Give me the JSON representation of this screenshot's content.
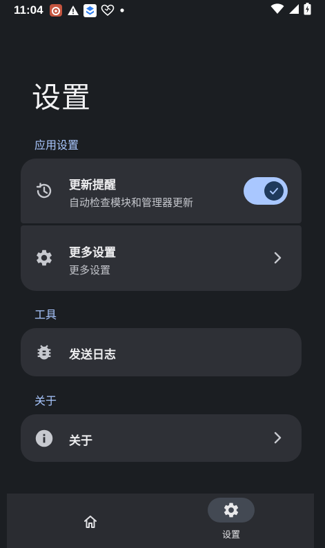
{
  "status_bar": {
    "time": "11:04",
    "icons": [
      "app-notification-icon",
      "warning-icon",
      "app-icon",
      "heart-icon",
      "dot-icon"
    ],
    "right_icons": [
      "wifi-icon",
      "signal-icon",
      "battery-icon"
    ]
  },
  "page": {
    "title": "设置"
  },
  "sections": {
    "app_settings": {
      "header": "应用设置",
      "update_reminder": {
        "title": "更新提醒",
        "subtitle": "自动检查模块和管理器更新",
        "enabled": true
      },
      "more_settings": {
        "title": "更多设置",
        "subtitle": "更多设置"
      }
    },
    "tools": {
      "header": "工具",
      "send_log": {
        "title": "发送日志"
      }
    },
    "about": {
      "header": "关于",
      "about_item": {
        "title": "关于"
      }
    }
  },
  "bottom_nav": {
    "home": {
      "label": "",
      "icon": "home-icon"
    },
    "settings": {
      "label": "设置",
      "icon": "gear-icon",
      "active": true
    }
  },
  "colors": {
    "background": "#1b1e22",
    "card": "#2e3036",
    "accent": "#a9c7ff",
    "toggle_knob": "#1f3a5c"
  }
}
